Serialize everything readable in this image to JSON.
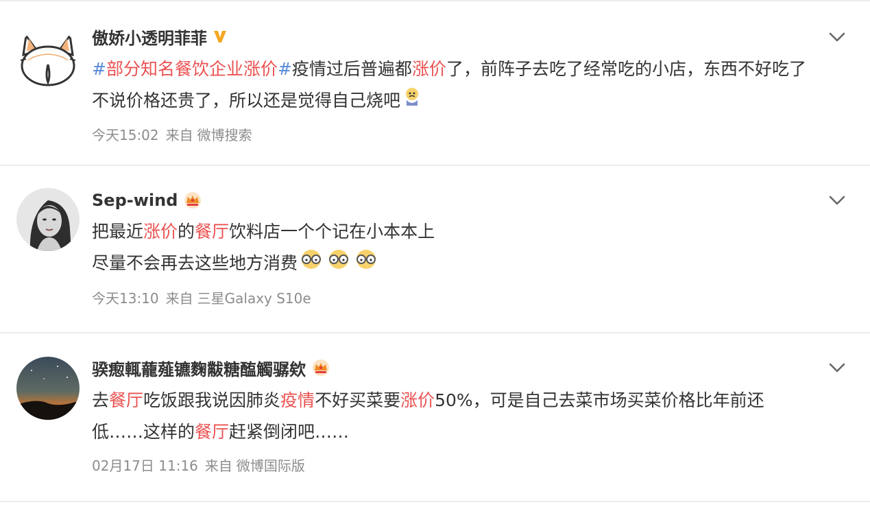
{
  "posts": [
    {
      "username": "傲娇小透明菲菲",
      "badge": "V",
      "line1": {
        "hash_open": "#",
        "topic": "部分知名餐饮企业涨价",
        "hash_close": "#",
        "t1": "疫情过后普遍都",
        "k1": "涨价",
        "t2": "了，前阵子去吃了经常吃的小店，东西不好吃了"
      },
      "line2": {
        "t1": "不说价格还贵了，所以还是觉得自己烧吧"
      },
      "time": "今天15:02",
      "from_label": "来自",
      "source": "微博搜索"
    },
    {
      "username": "Sep-wind",
      "line1": {
        "t1": "把最近",
        "k1": "涨价",
        "t2": "的",
        "k2": "餐厅",
        "t3": "饮料店一个个记在小本本上"
      },
      "line2": {
        "t1": "尽量不会再去这些地方消费"
      },
      "time": "今天13:10",
      "from_label": "来自",
      "source": "三星Galaxy S10e"
    },
    {
      "username": "骙瘛輒蘢薤镳麴黻糖醢觸骣欸",
      "line1": {
        "t1": "去",
        "k1": "餐厅",
        "t2": "吃饭跟我说因肺炎",
        "k2": "疫情",
        "t3": "不好买菜要",
        "k3": "涨价",
        "t4": "50%，可是自己去菜市场买菜价格比年前还"
      },
      "line2": {
        "t1": "低……这样的",
        "k1": "餐厅",
        "t2": "赶紧倒闭吧……"
      },
      "time": "02月17日 11:16",
      "from_label": "来自",
      "source": "微博国际版"
    }
  ],
  "colors": {
    "highlight": "#eb5252",
    "hashtag": "#5a8bd6",
    "meta": "#8c8c8c",
    "badge_v": "#f5a623"
  },
  "icons": [
    "corgi-avatar",
    "verified-v-icon",
    "crown-icon",
    "chevron-down-icon",
    "sad-emoji",
    "eyeglasses-emoji"
  ]
}
